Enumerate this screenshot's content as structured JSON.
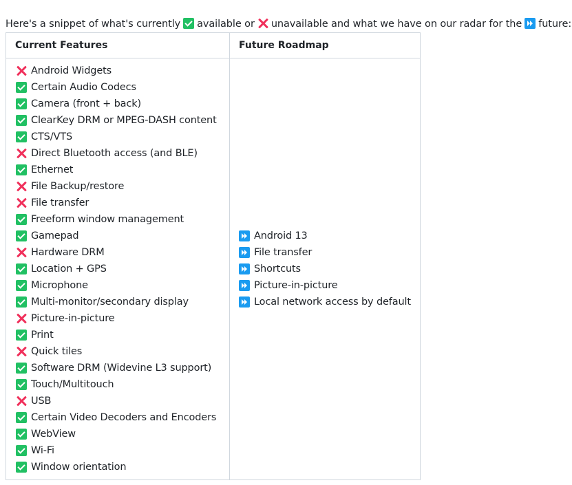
{
  "intro": {
    "part1": "Here's a snippet of what's currently",
    "icon1": "check-icon",
    "part2": "available or",
    "icon2": "cross-icon",
    "part3": "unavailable and what we have on our radar for the",
    "icon3": "fast-forward-icon",
    "part4": "future:"
  },
  "table": {
    "headers": [
      "Current Features",
      "Future Roadmap"
    ],
    "current_features": [
      {
        "status": "unavailable",
        "icon": "cross-icon",
        "label": "Android Widgets"
      },
      {
        "status": "available",
        "icon": "check-icon",
        "label": "Certain Audio Codecs"
      },
      {
        "status": "available",
        "icon": "check-icon",
        "label": "Camera (front + back)"
      },
      {
        "status": "available",
        "icon": "check-icon",
        "label": "ClearKey DRM or MPEG-DASH content"
      },
      {
        "status": "available",
        "icon": "check-icon",
        "label": "CTS/VTS"
      },
      {
        "status": "unavailable",
        "icon": "cross-icon",
        "label": "Direct Bluetooth access (and BLE)"
      },
      {
        "status": "available",
        "icon": "check-icon",
        "label": "Ethernet"
      },
      {
        "status": "unavailable",
        "icon": "cross-icon",
        "label": "File Backup/restore"
      },
      {
        "status": "unavailable",
        "icon": "cross-icon",
        "label": "File transfer"
      },
      {
        "status": "available",
        "icon": "check-icon",
        "label": "Freeform window management"
      },
      {
        "status": "available",
        "icon": "check-icon",
        "label": "Gamepad"
      },
      {
        "status": "unavailable",
        "icon": "cross-icon",
        "label": "Hardware DRM"
      },
      {
        "status": "available",
        "icon": "check-icon",
        "label": "Location + GPS"
      },
      {
        "status": "available",
        "icon": "check-icon",
        "label": "Microphone"
      },
      {
        "status": "available",
        "icon": "check-icon",
        "label": "Multi-monitor/secondary display"
      },
      {
        "status": "unavailable",
        "icon": "cross-icon",
        "label": "Picture-in-picture"
      },
      {
        "status": "available",
        "icon": "check-icon",
        "label": "Print"
      },
      {
        "status": "unavailable",
        "icon": "cross-icon",
        "label": "Quick tiles"
      },
      {
        "status": "available",
        "icon": "check-icon",
        "label": "Software DRM (Widevine L3 support)"
      },
      {
        "status": "available",
        "icon": "check-icon",
        "label": "Touch/Multitouch"
      },
      {
        "status": "unavailable",
        "icon": "cross-icon",
        "label": "USB"
      },
      {
        "status": "available",
        "icon": "check-icon",
        "label": "Certain Video Decoders and Encoders"
      },
      {
        "status": "available",
        "icon": "check-icon",
        "label": "WebView"
      },
      {
        "status": "available",
        "icon": "check-icon",
        "label": "Wi-Fi"
      },
      {
        "status": "available",
        "icon": "check-icon",
        "label": "Window orientation"
      }
    ],
    "future_roadmap": [
      {
        "icon": "fast-forward-icon",
        "label": "Android 13"
      },
      {
        "icon": "fast-forward-icon",
        "label": "File transfer"
      },
      {
        "icon": "fast-forward-icon",
        "label": "Shortcuts"
      },
      {
        "icon": "fast-forward-icon",
        "label": "Picture-in-picture"
      },
      {
        "icon": "fast-forward-icon",
        "label": "Local network access by default"
      }
    ]
  },
  "colors": {
    "available": "#21c063",
    "unavailable": "#f0305b",
    "future": "#1a9bf0",
    "border": "#d0d7de",
    "text": "#1f2328"
  }
}
